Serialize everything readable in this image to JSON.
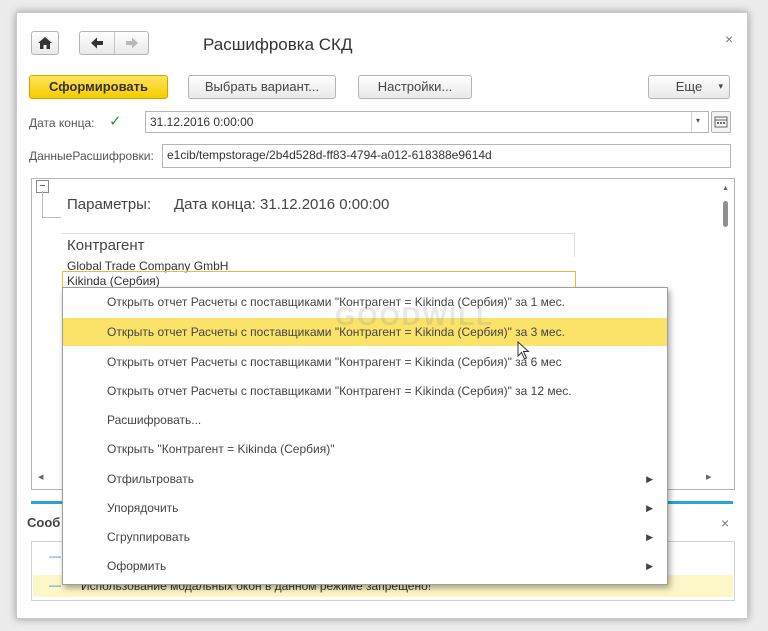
{
  "window": {
    "title": "Расшифровка СКД",
    "close_glyph": "×"
  },
  "toolbar": {
    "form_label": "Сформировать",
    "variant_label": "Выбрать вариант...",
    "settings_label": "Настройки...",
    "more_label": "Еще",
    "more_caret": "▾"
  },
  "fields": {
    "end_date_label": "Дата конца:",
    "end_date_value": "31.12.2016  0:00:00",
    "end_date_checked": "✓",
    "decode_label": "ДанныеРасшифровки:",
    "decode_value": "e1cib/tempstorage/2b4d528d-ff83-4794-a012-618388e9614d"
  },
  "report": {
    "collapse_glyph": "−",
    "params_label": "Параметры:",
    "params_value": "Дата конца: 31.12.2016 0:00:00",
    "column_header": "Контрагент",
    "rows": [
      "Global Trade Company GmbH",
      "Kikinda (Сербия)"
    ]
  },
  "context_menu": {
    "items": [
      {
        "label": "Открыть отчет Расчеты с поставщиками \"Контрагент = Kikinda (Сербия)\" за 1 мес."
      },
      {
        "label": "Открыть отчет Расчеты с поставщиками \"Контрагент = Kikinda (Сербия)\" за 3 мес."
      },
      {
        "label": "Открыть отчет Расчеты с поставщиками \"Контрагент = Kikinda (Сербия)\" за 6 мес"
      },
      {
        "label": "Открыть отчет Расчеты с поставщиками \"Контрагент = Kikinda (Сербия)\" за 12 мес."
      },
      {
        "label": "Расшифровать..."
      },
      {
        "label": "Открыть \"Контрагент = Kikinda (Сербия)\""
      },
      {
        "label": "Отфильтровать",
        "arrow": "▶"
      },
      {
        "label": "Упорядочить",
        "arrow": "▶"
      },
      {
        "label": "Сгруппировать",
        "arrow": "▶"
      },
      {
        "label": "Оформить",
        "arrow": "▶"
      }
    ]
  },
  "messages": {
    "header": "Сооб",
    "close_glyph": "×",
    "line_marker": "—",
    "text": "Использование модальных окон в данном режиме запрещено!"
  },
  "watermark": "GOODWILL",
  "colors": {
    "accent_yellow": "#f6cc00",
    "highlight": "#fbe36a",
    "separator_blue": "#29a3d8",
    "message_bg": "#fdf6c6"
  }
}
